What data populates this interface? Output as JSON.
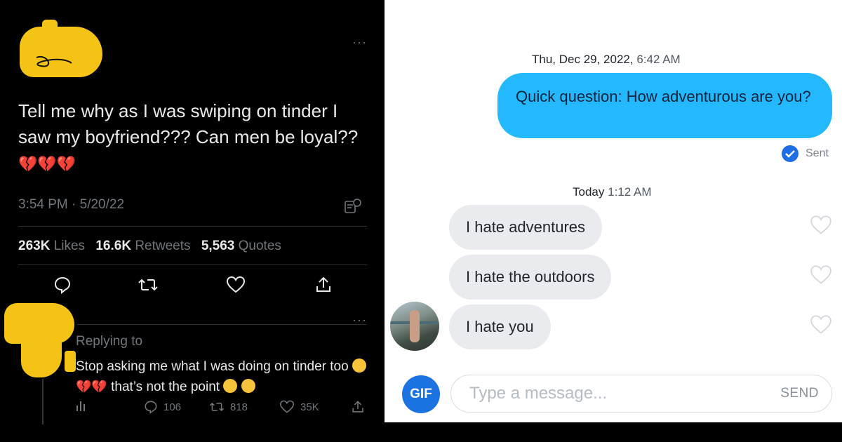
{
  "tweet": {
    "text": "Tell me why as I was swiping on tinder I saw my boyfriend??? Can men be loyal??",
    "time": "3:54 PM · 5/20/22",
    "likes_count": "263K",
    "likes_label": "Likes",
    "retweets_count": "16.6K",
    "retweets_label": "Retweets",
    "quotes_count": "5,563",
    "quotes_label": "Quotes",
    "emojis": "💔💔💔"
  },
  "reply": {
    "replying_to": "Replying to",
    "text_part1": "Stop asking me what I was doing on tinder too",
    "text_part2": "that’s not the point",
    "broken_hearts": "💔💔",
    "reply_count": "106",
    "retweet_count": "818",
    "like_count": "35K"
  },
  "chat": {
    "date_sent_day": "Thu, Dec 29, 2022,",
    "date_sent_time": "6:42 AM",
    "sent_message": "Quick question: How adventurous are you?",
    "sent_status": "Sent",
    "date_recv_day": "Today",
    "date_recv_time": "1:12 AM",
    "received": [
      "I hate adventures",
      "I hate the outdoors",
      "I hate you"
    ],
    "gif_label": "GIF",
    "input_placeholder": "Type a message...",
    "send_label": "SEND"
  },
  "colors": {
    "twitter_bg": "#000000",
    "sent_bubble": "#24b8ff",
    "received_bubble": "#e9ebee",
    "gif_button": "#1a73e0",
    "censor_yellow": "#f5c316"
  }
}
